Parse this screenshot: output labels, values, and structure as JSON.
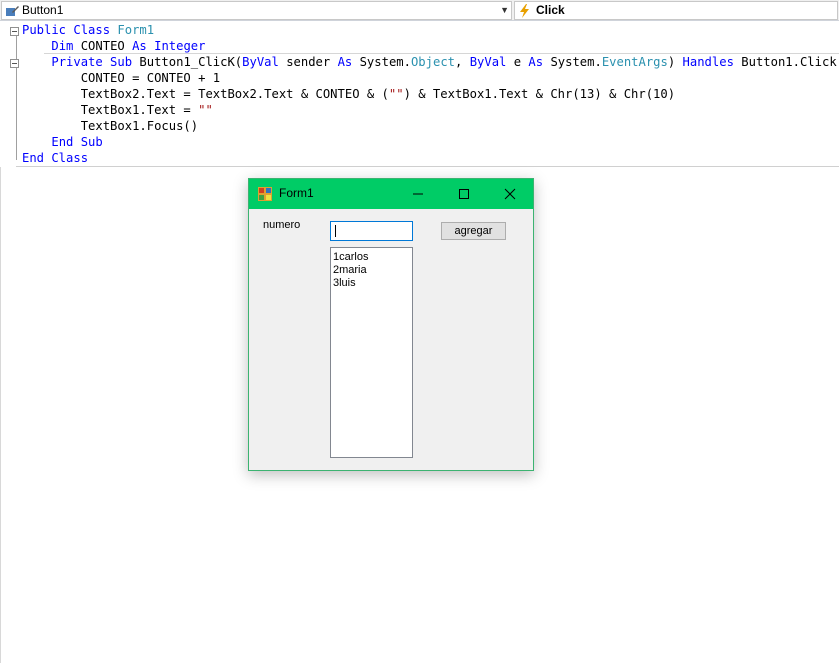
{
  "navbar": {
    "object_combo": "Button1",
    "event_combo": "Click"
  },
  "code": {
    "line1_kw1": "Public Class",
    "line1_cls": "Form1",
    "line2_kw": "Dim",
    "line2_var": "CONTEO",
    "line2_as": "As",
    "line2_type": "Integer",
    "line3_kw": "Private Sub",
    "line3_name": "Button1_ClicK(",
    "line3_byval1": "ByVal",
    "line3_sender": "sender",
    "line3_as1": "As",
    "line3_sys1": "System.",
    "line3_obj": "Object",
    "line3_comma": ",",
    "line3_byval2": "ByVal",
    "line3_e": "e",
    "line3_as2": "As",
    "line3_sys2": "System.",
    "line3_evargs": "EventArgs",
    "line3_close": ")",
    "line3_handles": "Handles",
    "line3_handler": "Button1.Click",
    "line4": "CONTEO = CONTEO + 1",
    "line5_a": "TextBox2.Text = TextBox2.Text & CONTEO & (",
    "line5_str": "\"\"",
    "line5_b": ") & TextBox1.Text & Chr(13) & Chr(10)",
    "line6_a": "TextBox1.Text = ",
    "line6_str": "\"\"",
    "line7": "TextBox1.Focus()",
    "line8": "End Sub",
    "line9": "End Class"
  },
  "form": {
    "title": "Form1",
    "label_numero": "numero",
    "input_value": "",
    "button_agregar": "agregar",
    "list_items": [
      "1carlos",
      "2maria",
      "3luis"
    ]
  },
  "colors": {
    "titlebar": "#00cc66",
    "keyword": "#0000ff",
    "type": "#2b91af",
    "string": "#a31515"
  }
}
